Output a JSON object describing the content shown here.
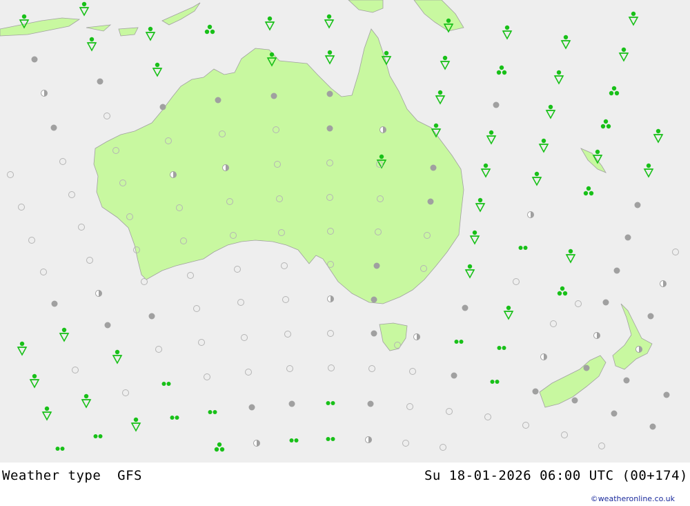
{
  "map": {
    "colors": {
      "sea": "#eeeeee",
      "land": "#c8f8a0",
      "coast": "#a0a0a0",
      "green": "#18c018",
      "gray": "#a0a0a0",
      "light_gray": "#b4b4b4"
    }
  },
  "footer": {
    "title": "Weather type  GFS",
    "datetime": "Su 18-01-2026 06:00 UTC (00+174)",
    "credit": "©weatheronline.co.uk"
  }
}
